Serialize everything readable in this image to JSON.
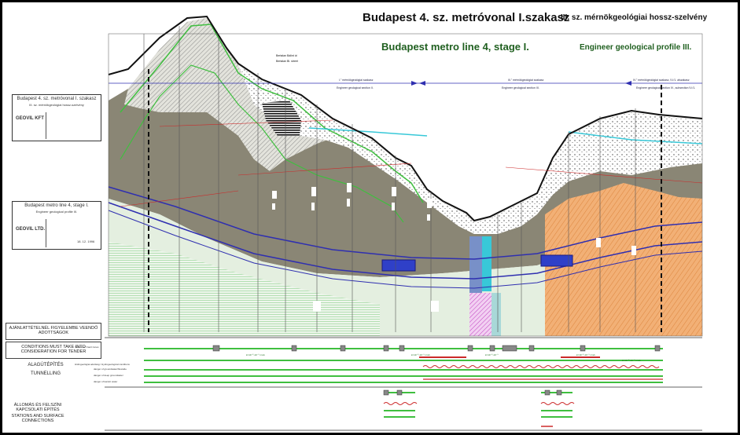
{
  "title_hu": "Budapest 4. sz. metróvonal I.szakasz",
  "subtitle_hu": "III. sz. mérnökgeológiai hossz-szelvény",
  "title_en": "Budapest metro line 4, stage I.",
  "subtitle_en": "Engineer geological profile III.",
  "street_label": {
    "hu": "Bertalan Bálint út",
    "en": "Bertalan Bl. street"
  },
  "sections": [
    {
      "hu": "I.\" mérnökgeológiai szakasz",
      "en": "Engineer geological section II."
    },
    {
      "hu": "III.\" mérnökgeológiai szakasz",
      "en": "Engineer geological section III."
    },
    {
      "hu": "IV.\" mérnökgeológiai szakasz, IV./1. alszakasz",
      "en": "Engineer geological section IV., subsection IV./1."
    }
  ],
  "title_block_hu": {
    "title": "Budapest 4. sz. metróvonal I. szakasz",
    "subtitle": "III. sz. mérnökgeológiai hossz-szelvény",
    "company": "GEOVIL KFT"
  },
  "title_block_en": {
    "title": "Budapest metro line 4, stage I.",
    "subtitle": "Engineer geological profile III.",
    "company": "GEOVIL LTD.",
    "date": "18. 12. 1996"
  },
  "left_boxes": {
    "tender_hu": "AJÁNLATTÉTELNÉL FIGYELEMBE VEENDŐ ADOTTSÁGOK",
    "tender_en": "CONDITIONS MUST TAKE INTO CONSIDERATION FOR TENDER",
    "tunnelling_hu": "ALAGÚTÉPÍTÉS",
    "tunnelling_en": "TUNNELLING",
    "stations_hu": "ÁLLOMÁS ÉS FELSZÍNI KAPCSOLATI ÉPÍTÉS",
    "stations_en": "STATIONS AND SURFACE CONNECTIONS"
  },
  "legend_rows": {
    "fault_zones": "Vetőzóna / Fault zones",
    "hydro": "Hidrogeológiai adottság / Hydrogeological conditions",
    "danger_ground": "danger of groundwater/flowside",
    "danger_deep": "danger of deep groundwater",
    "danger_karstic": "danger of karstic water"
  },
  "perm_labels": [
    "k=10⁻⁸-10⁻⁹ cm/s",
    "k=10⁻⁸-10⁻⁹ cm/s",
    "k=10⁻⁸-10⁻⁹",
    "k=10⁻⁸-10⁻⁹ cm/s",
    "k=10⁻⁸-10⁻⁹ cm/s"
  ],
  "colors": {
    "frame": "#000000",
    "ground_grey": "#8a8675",
    "light_green": "#e4efe0",
    "slope_green": "#3fbf3f",
    "tunnel_blue": "#2f2fb0",
    "water_cyan": "#38c8d8",
    "orange": "#e89a56",
    "red": "#cc2a2a"
  }
}
